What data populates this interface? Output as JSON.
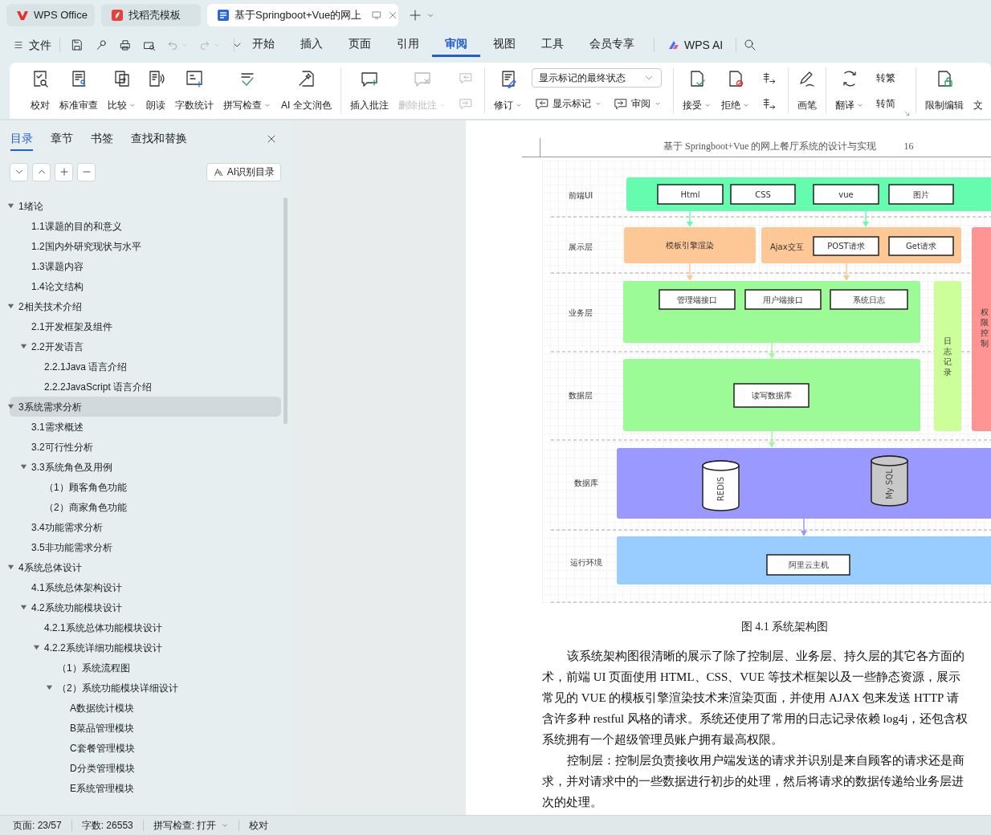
{
  "tabs": [
    {
      "label": "WPS Office",
      "selected": false
    },
    {
      "label": "找稻壳模板",
      "selected": false
    },
    {
      "label": "基于Springboot+Vue的网上",
      "selected": true
    }
  ],
  "file_menu": "文件",
  "menu": [
    {
      "label": "开始",
      "selected": false
    },
    {
      "label": "插入",
      "selected": false
    },
    {
      "label": "页面",
      "selected": false
    },
    {
      "label": "引用",
      "selected": false
    },
    {
      "label": "审阅",
      "selected": true
    },
    {
      "label": "视图",
      "selected": false
    },
    {
      "label": "工具",
      "selected": false
    },
    {
      "label": "会员专享",
      "selected": false
    }
  ],
  "wps_ai": "WPS AI",
  "ribbon": [
    [
      {
        "kind": "large",
        "label": "校对",
        "dropdown": false,
        "disabled": false
      },
      {
        "kind": "large",
        "label": "标准审查",
        "dropdown": false,
        "disabled": false
      },
      {
        "kind": "large",
        "label": "比较",
        "dropdown": true,
        "disabled": false
      },
      {
        "kind": "large",
        "label": "朗读",
        "dropdown": false,
        "disabled": false
      },
      {
        "kind": "large",
        "label": "字数统计",
        "dropdown": false,
        "disabled": false
      },
      {
        "kind": "large",
        "label": "拼写检查",
        "dropdown": true,
        "disabled": false
      },
      {
        "kind": "large",
        "label": "AI 全文润色",
        "dropdown": false,
        "disabled": false
      }
    ],
    [
      {
        "kind": "large",
        "label": "插入批注",
        "dropdown": false,
        "disabled": false
      },
      {
        "kind": "large",
        "label": "删除批注",
        "dropdown": true,
        "disabled": true
      },
      {
        "kind": "stack",
        "items": [
          {
            "kind": "icon",
            "disabled": true
          },
          {
            "kind": "icon",
            "disabled": true
          }
        ]
      }
    ],
    [
      {
        "kind": "large",
        "label": "修订",
        "dropdown": true,
        "disabled": false
      },
      {
        "kind": "stack",
        "items": [
          {
            "kind": "select",
            "value": "显示标记的最终状态"
          },
          {
            "kind": "row",
            "items": [
              {
                "kind": "small",
                "label": "显示标记",
                "dropdown": true,
                "disabled": false
              },
              {
                "kind": "small",
                "label": "审阅",
                "dropdown": true,
                "disabled": false
              }
            ]
          }
        ]
      }
    ],
    [
      {
        "kind": "large",
        "label": "接受",
        "dropdown": true,
        "disabled": false
      },
      {
        "kind": "large",
        "label": "拒绝",
        "dropdown": true,
        "disabled": false
      },
      {
        "kind": "stack",
        "items": [
          {
            "kind": "icon",
            "disabled": false
          },
          {
            "kind": "icon",
            "disabled": false
          }
        ]
      }
    ],
    [
      {
        "kind": "large",
        "label": "画笔",
        "dropdown": false,
        "disabled": false
      }
    ],
    [
      {
        "kind": "large",
        "label": "翻译",
        "dropdown": true,
        "disabled": false
      },
      {
        "kind": "stack",
        "items": [
          {
            "kind": "small",
            "label": "转繁",
            "dropdown": false,
            "disabled": false
          },
          {
            "kind": "small",
            "label": "转简",
            "dropdown": false,
            "disabled": false
          }
        ]
      },
      {
        "kind": "launcher"
      }
    ],
    [
      {
        "kind": "large",
        "label": "限制编辑",
        "dropdown": false,
        "disabled": false
      },
      {
        "kind": "large",
        "label": "文",
        "dropdown": false,
        "disabled": false
      }
    ]
  ],
  "toc": {
    "tabs": [
      {
        "label": "目录",
        "selected": true
      },
      {
        "label": "章节",
        "selected": false
      },
      {
        "label": "书签",
        "selected": false
      },
      {
        "label": "查找和替换",
        "selected": false
      }
    ],
    "ai_button": "AI识别目录",
    "items": [
      {
        "label": "1绪论",
        "selected": false,
        "expanded": true,
        "children": [
          {
            "label": "1.1课题的目的和意义",
            "selected": false
          },
          {
            "label": "1.2国内外研究现状与水平",
            "selected": false
          },
          {
            "label": "1.3课题内容",
            "selected": false
          },
          {
            "label": "1.4论文结构",
            "selected": false
          }
        ]
      },
      {
        "label": "2相关技术介绍",
        "selected": false,
        "expanded": true,
        "children": [
          {
            "label": "2.1开发框架及组件",
            "selected": false
          },
          {
            "label": "2.2开发语言",
            "selected": false,
            "expanded": true,
            "children": [
              {
                "label": "2.2.1Java 语言介绍",
                "selected": false
              },
              {
                "label": "2.2.2JavaScript 语言介绍",
                "selected": false
              }
            ]
          }
        ]
      },
      {
        "label": "3系统需求分析",
        "selected": true,
        "expanded": true,
        "children": [
          {
            "label": "3.1需求概述",
            "selected": false
          },
          {
            "label": "3.2可行性分析",
            "selected": false
          },
          {
            "label": "3.3系统角色及用例",
            "selected": false,
            "expanded": true,
            "children": [
              {
                "label": "（1）顾客角色功能",
                "selected": false
              },
              {
                "label": "（2）商家角色功能",
                "selected": false
              }
            ]
          },
          {
            "label": "3.4功能需求分析",
            "selected": false
          },
          {
            "label": "3.5非功能需求分析",
            "selected": false
          }
        ]
      },
      {
        "label": "4系统总体设计",
        "selected": false,
        "expanded": true,
        "children": [
          {
            "label": "4.1系统总体架构设计",
            "selected": false
          },
          {
            "label": "4.2系统功能模块设计",
            "selected": false,
            "expanded": true,
            "children": [
              {
                "label": "4.2.1系统总体功能模块设计",
                "selected": false
              },
              {
                "label": "4.2.2系统详细功能模块设计",
                "selected": false,
                "expanded": true,
                "children": [
                  {
                    "label": "（1）系统流程图",
                    "selected": false
                  },
                  {
                    "label": "（2）系统功能模块详细设计",
                    "selected": false,
                    "expanded": true,
                    "children": [
                      {
                        "label": "A数据统计模块",
                        "selected": false
                      },
                      {
                        "label": "B菜品管理模块",
                        "selected": false
                      },
                      {
                        "label": "C套餐管理模块",
                        "selected": false
                      },
                      {
                        "label": "D分类管理模块",
                        "selected": false
                      },
                      {
                        "label": "E系统管理模块",
                        "selected": false
                      }
                    ]
                  }
                ]
              }
            ]
          }
        ]
      }
    ]
  },
  "document": {
    "header": "基于 Springboot+Vue 的网上餐厅系统的设计与实现",
    "page_number": "16",
    "diagram": {
      "layer_labels": [
        "前端UI",
        "展示层",
        "业务层",
        "数据层",
        "数据库",
        "运行环境"
      ],
      "frontend_ui": {
        "color": "#66fcb0",
        "items": [
          "Html",
          "CSS",
          "vue",
          "图片"
        ]
      },
      "presentation": {
        "color": "#fec896",
        "template": "模板引擎渲染",
        "ajax": "Ajax交互",
        "items": [
          "POST请求",
          "Get请求"
        ]
      },
      "business": {
        "color": "#9cfb96",
        "items": [
          "管理端接口",
          "用户端接口",
          "系统日志"
        ]
      },
      "data": {
        "color": "#9cfb96",
        "items": [
          "读写数据库"
        ]
      },
      "logging": {
        "color": "#ccff99",
        "label": "日志记录"
      },
      "access_control": {
        "color": "#ff9494",
        "label": "权限控制"
      },
      "database": {
        "color": "#9999ff",
        "stores": [
          {
            "label": "REDIS",
            "color": "#ffffff"
          },
          {
            "label": "My SQL",
            "color": "#c8c8c8"
          }
        ]
      },
      "runtime": {
        "color": "#99ccff",
        "items": [
          "阿里云主机"
        ]
      }
    },
    "caption": "图 4.1 系统架构图",
    "paragraphs": [
      {
        "lines": [
          "该系统架构图很清晰的展示了除了控制层、业务层、持久层的其它各方面的",
          "术，前端 UI 页面使用 HTML、CSS、VUE 等技术框架以及一些静态资源，展示",
          "常见的 VUE 的模板引擎渲染技术来渲染页面，并使用 AJAX 包来发送 HTTP 请",
          "含许多种 restful 风格的请求。系统还使用了常用的日志记录依赖 log4j，还包含权",
          "系统拥有一个超级管理员账户拥有最高权限。"
        ]
      },
      {
        "lines": [
          "控制层：控制层负责接收用户端发送的请求并识别是来自顾客的请求还是商",
          "求，并对请求中的一些数据进行初步的处理，然后将请求的数据传递给业务层进",
          "次的处理。"
        ]
      }
    ]
  },
  "status_bar": {
    "page": "页面: 23/57",
    "words": "字数: 26553",
    "spell_check": "拼写检查: 打开",
    "proofread": "校对"
  }
}
